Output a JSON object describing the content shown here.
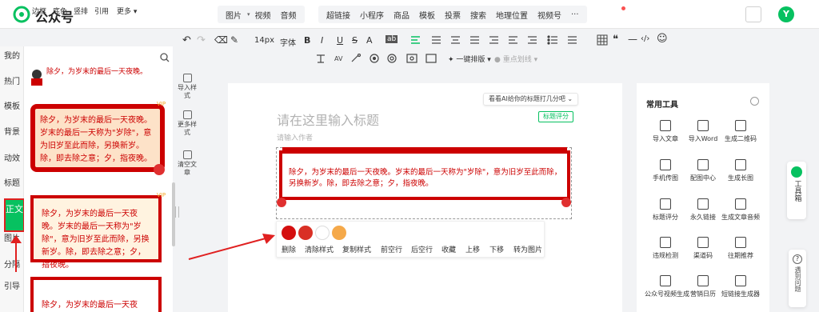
{
  "app": {
    "brand": "公众号"
  },
  "insert_bar": {
    "group1": [
      "图片",
      "视频",
      "音频"
    ],
    "group2": [
      "超链接",
      "小程序",
      "商品",
      "模板",
      "投票",
      "搜索",
      "地理位置",
      "视频号",
      "···"
    ]
  },
  "avatar": {
    "initial": "Y"
  },
  "format_toolbar": {
    "undo": "↶",
    "redo": "↷",
    "clear_format": "⌫",
    "brush": "✎",
    "font_size": "14px",
    "font": "字体",
    "bold": "B",
    "italic": "I",
    "underline": "U",
    "strike": "S",
    "font_color": "A",
    "bg_color": "ab",
    "quote": "❝",
    "hr": "—",
    "code": "‹/›",
    "emoji": "☺",
    "one_click_layout": "一键排版",
    "focus_mark": "重点划线"
  },
  "left_tabs": [
    "我的",
    "热门",
    "模板",
    "背景",
    "动效",
    "标题",
    "正文",
    "图片",
    "分隔",
    "引导"
  ],
  "active_tab": "正文",
  "style_filters": [
    "边框",
    "底色",
    "竖排",
    "引用",
    "更多"
  ],
  "style_cards": [
    "除夕，为岁末的最后一天夜晚。岁末的最后一天称为\"岁除\"，意为旧岁至此而除，另换新岁。除，即去除之意；夕，指夜晚。",
    "除夕，为岁末的最后一天夜晚。岁末的最后一天称为\"岁除\"，意为旧岁至此而除，另换新岁。除，即去除之意；夕，指夜晚。",
    "除夕，为岁末的最后一天夜晚。岁末的最后一天称为\"岁除\"，意为旧岁至此而除，另换新岁。除，即去除之意；夕，指夜晚。"
  ],
  "card_top_snippet": "除夕，为岁末的最后一天夜晚。",
  "vip_badge": "VIP",
  "util_buttons": [
    "导入样式",
    "更多样式",
    "清空文章"
  ],
  "editor": {
    "ai_tip": "看看AI给你的标题打几分吧 ⌄",
    "score_button": "标题评分",
    "title_placeholder": "请在这里输入标题",
    "author_placeholder": "请输入作者",
    "block_text": "除夕，为岁末的最后一天夜晚。岁末的最后一天称为\"岁除\"，意为旧岁至此而除，另换新岁。除，即去除之意；夕，指夜晚。"
  },
  "context_colors": [
    "#d40f0f",
    "#d93025",
    "#ffffff",
    "#f5a94a"
  ],
  "context_actions": [
    "删除",
    "清除样式",
    "复制样式",
    "前空行",
    "后空行",
    "收藏",
    "上移",
    "下移",
    "转为图片"
  ],
  "tools": {
    "title": "常用工具",
    "items": [
      "导入文章",
      "导入Word",
      "生成二维码",
      "手机传图",
      "配图中心",
      "生成长图",
      "标题评分",
      "永久链接",
      "生成文章音频",
      "违规检测",
      "渠道码",
      "往期推荐",
      "公众号视频生成",
      "营销日历",
      "短链接生成器"
    ]
  },
  "toolbox": {
    "label": "工具箱"
  },
  "help": {
    "icon": "?",
    "label": "遇到问题"
  },
  "colors": {
    "brand_green": "#07c160",
    "accent_red": "#cc0000"
  }
}
